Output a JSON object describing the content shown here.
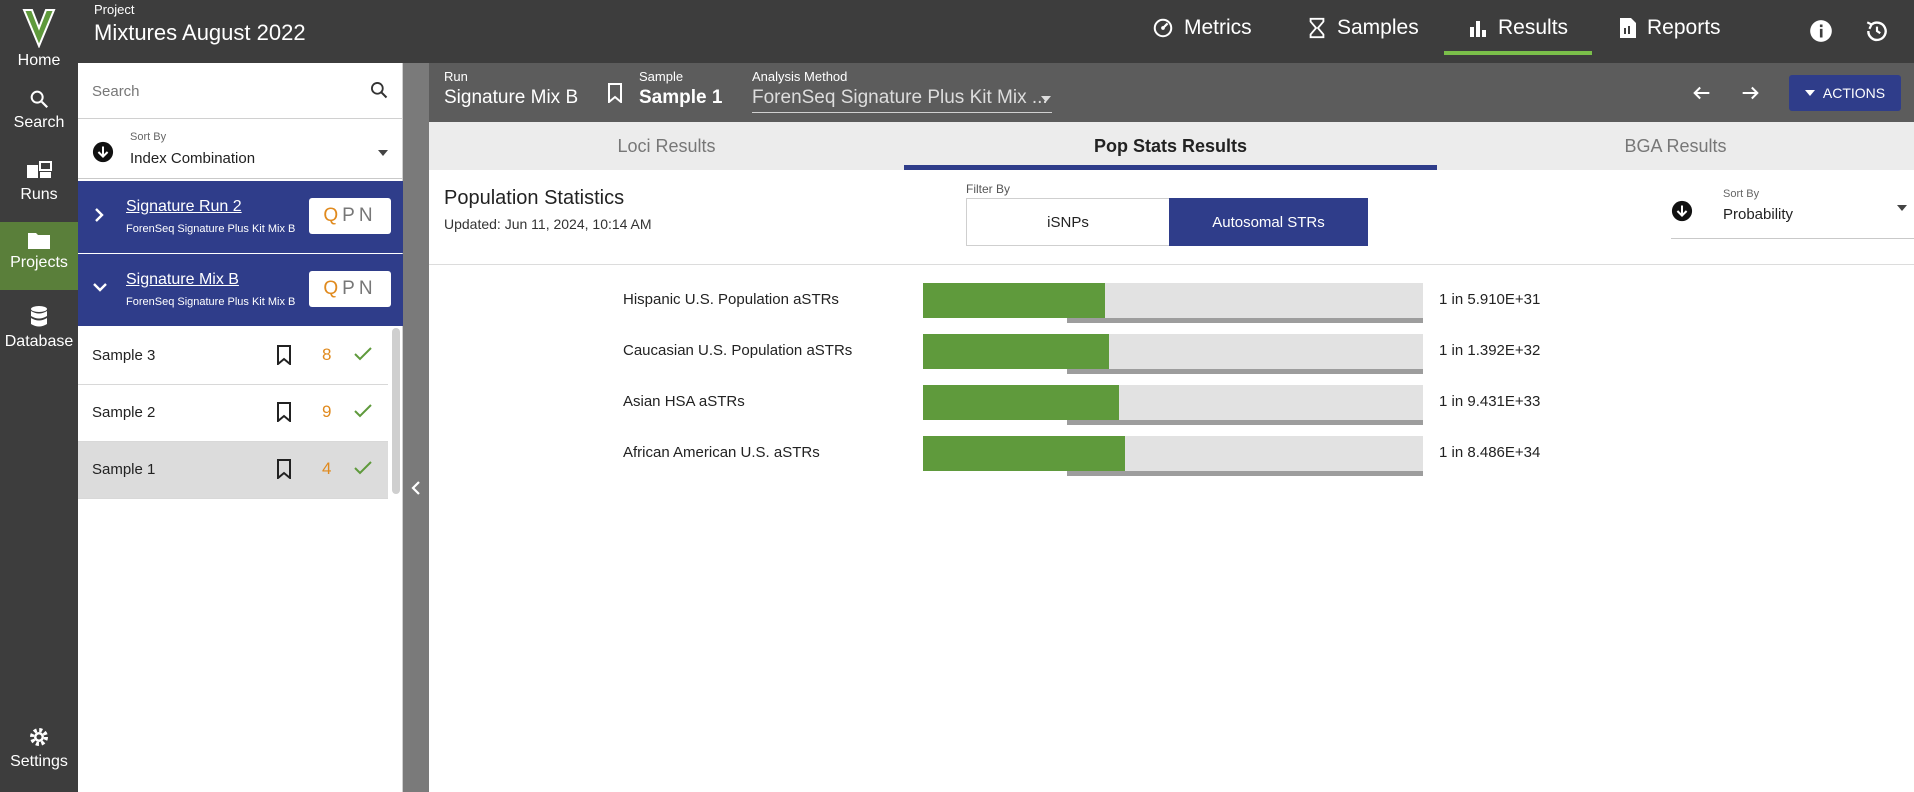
{
  "rail": {
    "home": "Home",
    "search": "Search",
    "runs": "Runs",
    "projects": "Projects",
    "database": "Database",
    "settings": "Settings"
  },
  "header": {
    "project_eyebrow": "Project",
    "project_title": "Mixtures August 2022",
    "nav": [
      "Metrics",
      "Samples",
      "Results",
      "Reports"
    ],
    "active_nav": "Results",
    "accent": "#7bbf4a"
  },
  "list_panel": {
    "search_placeholder": "Search",
    "sort_eyebrow": "Sort By",
    "sort_value": "Index Combination",
    "runs": [
      {
        "name": "Signature Run 2",
        "kit": "ForenSeq Signature Plus Kit Mix B",
        "expanded": false,
        "qpn": [
          "Q",
          "P",
          "N"
        ]
      },
      {
        "name": "Signature Mix B",
        "kit": "ForenSeq Signature Plus Kit Mix B",
        "expanded": true,
        "qpn": [
          "Q",
          "P",
          "N"
        ]
      }
    ],
    "samples": [
      {
        "name": "Sample 3",
        "count": "8",
        "selected": false
      },
      {
        "name": "Sample 2",
        "count": "9",
        "selected": false
      },
      {
        "name": "Sample 1",
        "count": "4",
        "selected": true
      }
    ]
  },
  "main_header": {
    "run_eyebrow": "Run",
    "run_value": "Signature Mix B",
    "sample_eyebrow": "Sample",
    "sample_value": "Sample 1",
    "method_eyebrow": "Analysis Method",
    "method_value": "ForenSeq Signature Plus Kit Mix ...",
    "actions_label": "ACTIONS"
  },
  "tabs": [
    "Loci Results",
    "Pop Stats Results",
    "BGA Results"
  ],
  "active_tab": "Pop Stats Results",
  "content": {
    "title": "Population Statistics",
    "updated": "Updated: Jun 11, 2024, 10:14 AM",
    "filter_eyebrow": "Filter By",
    "filters": [
      "iSNPs",
      "Autosomal STRs"
    ],
    "active_filter": "Autosomal STRs",
    "sort_eyebrow": "Sort By",
    "sort_value": "Probability"
  },
  "chart_data": {
    "type": "bar",
    "orientation": "horizontal",
    "categories": [
      "Hispanic U.S. Population aSTRs",
      "Caucasian U.S. Population aSTRs",
      "Asian HSA aSTRs",
      "African American U.S. aSTRs"
    ],
    "values": [
      0.364,
      0.371,
      0.391,
      0.403
    ],
    "labels": [
      "1 in 5.910E+31",
      "1 in 1.392E+32",
      "1 in 9.431E+33",
      "1 in 8.486E+34"
    ],
    "colors": {
      "fill": "#5f9a3c",
      "track": "#e2e2e2",
      "underline": "#9d9d9d"
    }
  }
}
